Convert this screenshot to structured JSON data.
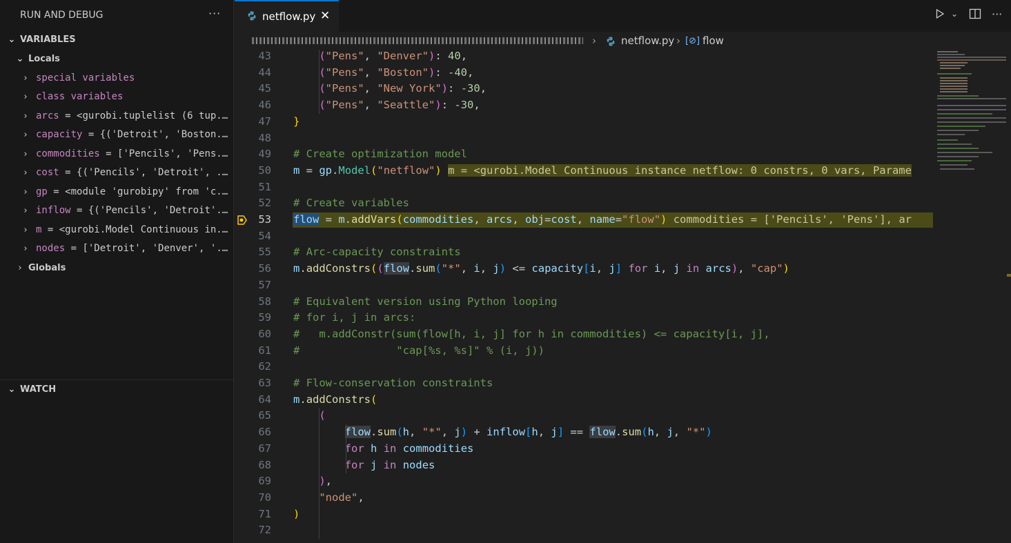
{
  "sidebar": {
    "title": "RUN AND DEBUG",
    "more": "···",
    "variables_header": "VARIABLES",
    "locals_label": "Locals",
    "globals_label": "Globals",
    "watch_header": "WATCH",
    "locals": [
      {
        "name": "special variables",
        "value": ""
      },
      {
        "name": "class variables",
        "value": ""
      },
      {
        "name": "arcs",
        "value": "<gurobi.tuplelist (6 tup..."
      },
      {
        "name": "capacity",
        "value": "{('Detroit', 'Boston..."
      },
      {
        "name": "commodities",
        "value": "['Pencils', 'Pens..."
      },
      {
        "name": "cost",
        "value": "{('Pencils', 'Detroit', ..."
      },
      {
        "name": "gp",
        "value": "<module 'gurobipy' from 'c..."
      },
      {
        "name": "inflow",
        "value": "{('Pencils', 'Detroit'..."
      },
      {
        "name": "m",
        "value": "<gurobi.Model Continuous in..."
      },
      {
        "name": "nodes",
        "value": "['Detroit', 'Denver', '..."
      }
    ]
  },
  "tab": {
    "label": "netflow.py",
    "close": "✕"
  },
  "breadcrumb": {
    "file": "netflow.py",
    "symbol": "flow"
  },
  "editor": {
    "line_numbers": [
      "43",
      "44",
      "45",
      "46",
      "47",
      "48",
      "49",
      "50",
      "51",
      "52",
      "53",
      "54",
      "55",
      "56",
      "57",
      "58",
      "59",
      "60",
      "61",
      "62",
      "63",
      "64",
      "65",
      "66",
      "67",
      "68",
      "69",
      "70",
      "71",
      "72"
    ],
    "inline_values": {
      "line50": "m = <gurobi.Model Continuous instance netflow: 0 constrs, 0 vars, Parame",
      "line53": "commodities = ['Pencils', 'Pens'], ar"
    },
    "current_line": "53"
  },
  "colors": {
    "accent": "#0078d4",
    "keyword": "#c586c0",
    "string": "#ce9178",
    "comment": "#6a9955",
    "debug_highlight": "#4b4b18"
  },
  "icons": {
    "run": "play-icon",
    "split": "split-editor-icon",
    "more": "more-actions-icon"
  }
}
